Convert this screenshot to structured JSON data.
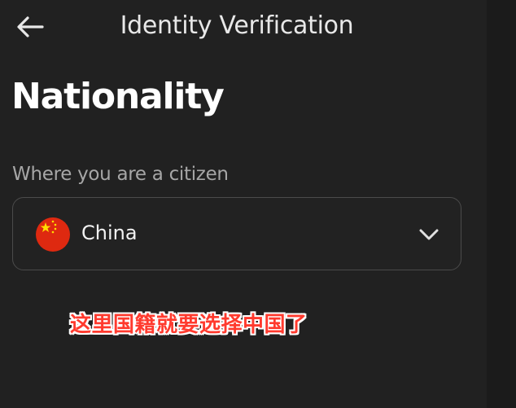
{
  "header": {
    "title": "Identity Verification",
    "back_icon": "arrow-left-icon"
  },
  "page": {
    "title": "Nationality"
  },
  "nationality_field": {
    "label": "Where you are a citizen",
    "selected_value": "China",
    "flag_icon": "china-flag-icon",
    "dropdown_icon": "chevron-down-icon"
  },
  "overlay": {
    "caption": "这里国籍就要选择中国了"
  },
  "colors": {
    "background": "#212121",
    "text_primary": "#ffffff",
    "text_secondary": "#a6a6a6",
    "border": "#4b4b4b",
    "caption": "#ff3a2e"
  }
}
